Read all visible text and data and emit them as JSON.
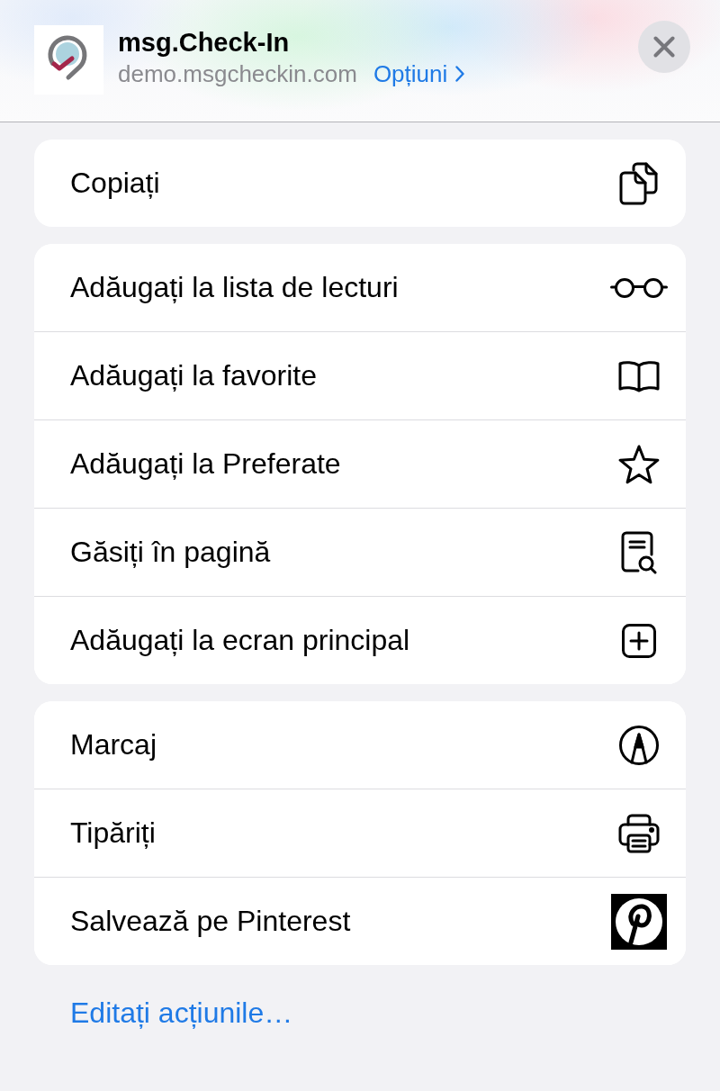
{
  "header": {
    "title": "msg.Check-In",
    "url": "demo.msgcheckin.com",
    "options_link": "Opțiuni"
  },
  "action_groups": [
    {
      "actions": [
        {
          "label": "Copiați",
          "kind": "copy"
        }
      ]
    },
    {
      "actions": [
        {
          "label": "Adăugați la lista de lecturi",
          "kind": "readinglist"
        },
        {
          "label": "Adăugați la favorite",
          "kind": "bookmark"
        },
        {
          "label": "Adăugați la Preferate",
          "kind": "favorite"
        },
        {
          "label": "Găsiți în pagină",
          "kind": "find"
        },
        {
          "label": "Adăugați la ecran principal",
          "kind": "homescreen"
        }
      ]
    },
    {
      "actions": [
        {
          "label": "Marcaj",
          "kind": "markup"
        },
        {
          "label": "Tipăriți",
          "kind": "print"
        },
        {
          "label": "Salvează pe Pinterest",
          "kind": "pinterest"
        }
      ]
    }
  ],
  "edit_actions_link": "Editați acțiunile…"
}
